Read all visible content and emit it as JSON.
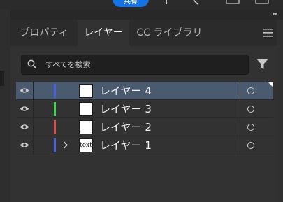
{
  "app_bar": {
    "button_label": "共有"
  },
  "tabs": [
    {
      "label": "プロパティ",
      "active": false
    },
    {
      "label": "レイヤー",
      "active": true
    },
    {
      "label": "CC ライブラリ",
      "active": false
    }
  ],
  "search": {
    "placeholder": "すべてを検索",
    "value": ""
  },
  "layers": [
    {
      "name": "レイヤー 4",
      "color": "#4a63e6",
      "thumb_text": "",
      "selected": true,
      "expandable": false
    },
    {
      "name": "レイヤー 3",
      "color": "#3cd64a",
      "thumb_text": "",
      "selected": false,
      "expandable": false
    },
    {
      "name": "レイヤー 2",
      "color": "#e24b4b",
      "thumb_text": "",
      "selected": false,
      "expandable": false
    },
    {
      "name": "レイヤー 1",
      "color": "#4a63e6",
      "thumb_text": "text",
      "selected": false,
      "expandable": true
    }
  ],
  "icons": {
    "collapse": "double-chevron-right-icon",
    "menu": "hamburger-menu-icon",
    "search": "search-icon",
    "filter": "filter-icon",
    "visibility": "eye-icon",
    "twirl": "chevron-right-icon",
    "target": "target-circle-icon"
  },
  "colors": {
    "accent": "#1473e6",
    "selection": "#4b5b6f"
  }
}
